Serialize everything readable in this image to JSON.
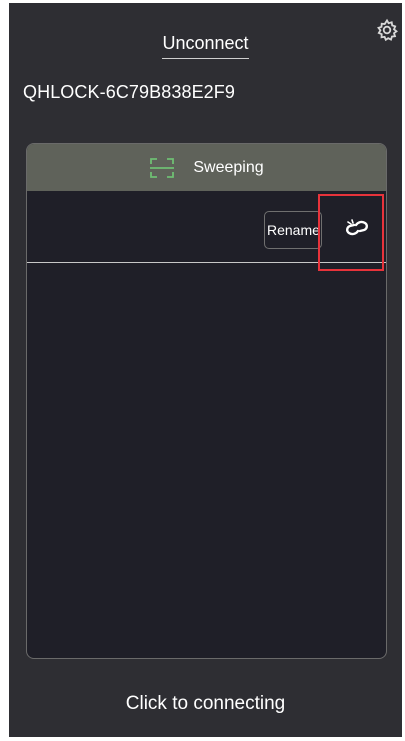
{
  "header": {
    "title": "Unconnect",
    "settings_icon": "gear-icon"
  },
  "panel": {
    "status_label": "Sweeping",
    "status_icon": "scan-icon",
    "devices": [
      {
        "name": "QHLOCK-6C79B838E2F9",
        "rename_label": "Rename",
        "action_icon": "link-icon"
      }
    ]
  },
  "footer": {
    "connect_label": "Click to connecting"
  },
  "colors": {
    "background": "#2e2e33",
    "panel": "#1f1f28",
    "panel_header": "#5f625a",
    "scan_icon": "#6fbf73",
    "highlight": "#e8333b"
  }
}
